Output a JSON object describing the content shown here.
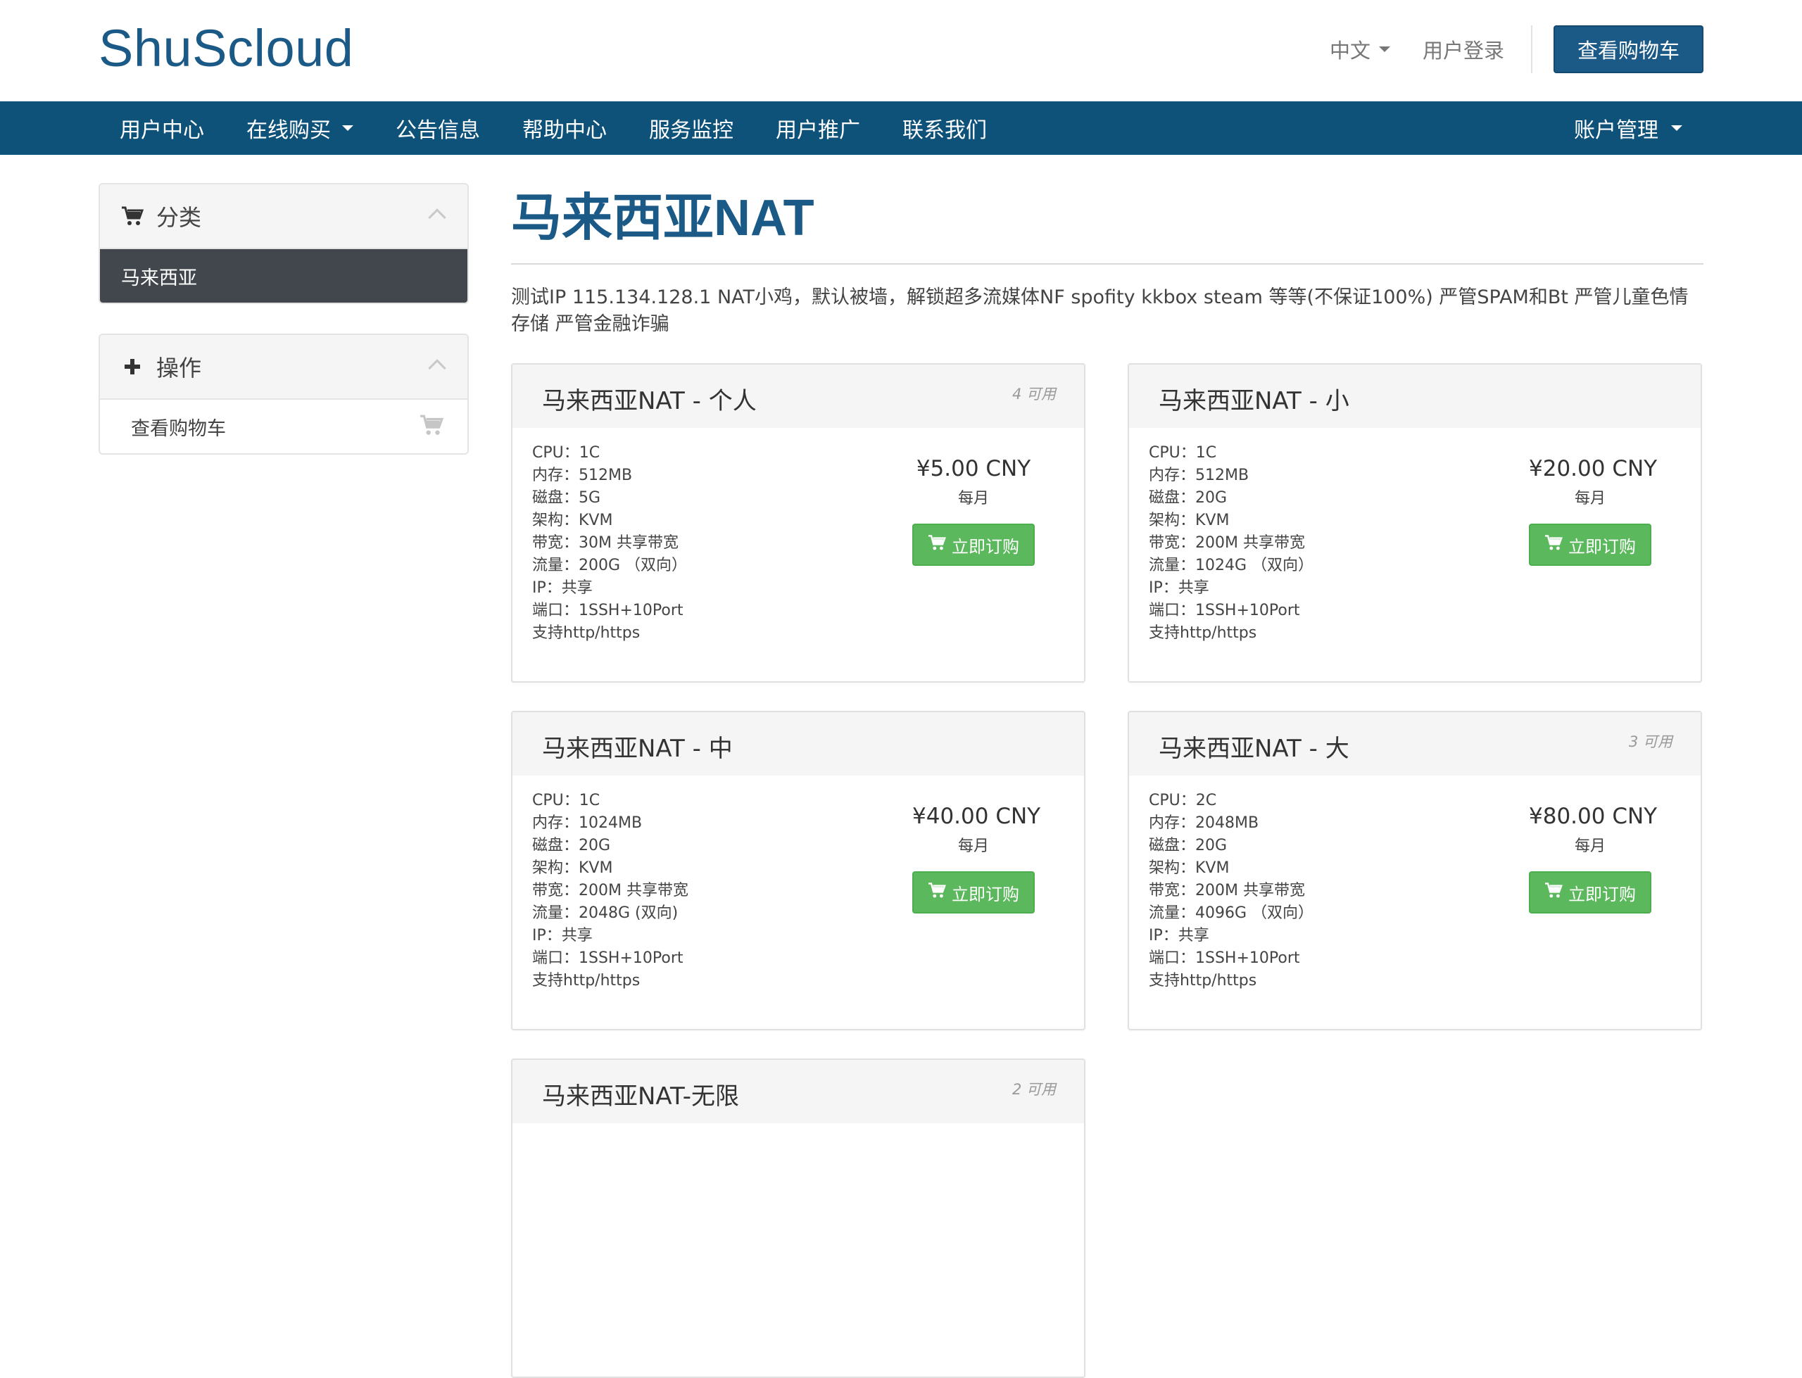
{
  "header": {
    "logo": "ShuScloud",
    "language": "中文",
    "login": "用户登录",
    "view_cart": "查看购物车"
  },
  "nav": {
    "items": [
      {
        "label": "用户中心",
        "dropdown": false
      },
      {
        "label": "在线购买",
        "dropdown": true
      },
      {
        "label": "公告信息",
        "dropdown": false
      },
      {
        "label": "帮助中心",
        "dropdown": false
      },
      {
        "label": "服务监控",
        "dropdown": false
      },
      {
        "label": "用户推广",
        "dropdown": false
      },
      {
        "label": "联系我们",
        "dropdown": false
      }
    ],
    "account": "账户管理"
  },
  "sidebar": {
    "categories": {
      "title": "分类",
      "icon": "cart-icon",
      "items": [
        "马来西亚"
      ]
    },
    "actions": {
      "title": "操作",
      "icon": "plus-icon",
      "items": [
        "查看购物车"
      ]
    }
  },
  "main": {
    "title": "马来西亚NAT",
    "description": "测试IP 115.134.128.1 NAT小鸡，默认被墙，解锁超多流媒体NF spofity kkbox steam 等等(不保证100%) 严管SPAM和Bt 严管儿童色情存储 严管金融诈骗",
    "order_label": "立即订购",
    "products": [
      {
        "name": "马来西亚NAT - 个人",
        "availability": "4 可用",
        "price": "¥5.00 CNY",
        "period": "每月",
        "specs": [
          "CPU：1C",
          "内存：512MB",
          "磁盘：5G",
          "架构：KVM",
          "带宽：30M 共享带宽",
          "流量：200G （双向）",
          "IP：共享",
          "端口：1SSH+10Port",
          "支持http/https"
        ]
      },
      {
        "name": "马来西亚NAT - 小",
        "availability": "",
        "price": "¥20.00 CNY",
        "period": "每月",
        "specs": [
          "CPU：1C",
          "内存：512MB",
          "磁盘：20G",
          "架构：KVM",
          "带宽：200M 共享带宽",
          "流量：1024G （双向）",
          "IP：共享",
          "端口：1SSH+10Port",
          "支持http/https"
        ]
      },
      {
        "name": "马来西亚NAT - 中",
        "availability": "",
        "price": "¥40.00 CNY",
        "period": "每月",
        "specs": [
          "CPU：1C",
          "内存：1024MB",
          "磁盘：20G",
          "架构：KVM",
          "带宽：200M 共享带宽",
          "流量：2048G (双向)",
          "IP：共享",
          "端口：1SSH+10Port",
          "支持http/https"
        ]
      },
      {
        "name": "马来西亚NAT - 大",
        "availability": "3 可用",
        "price": "¥80.00 CNY",
        "period": "每月",
        "specs": [
          "CPU：2C",
          "内存：2048MB",
          "磁盘：20G",
          "架构：KVM",
          "带宽：200M 共享带宽",
          "流量：4096G （双向）",
          "IP：共享",
          "端口：1SSH+10Port",
          "支持http/https"
        ]
      },
      {
        "name": "马来西亚NAT-无限",
        "availability": "2 可用",
        "price": "",
        "period": "",
        "specs": []
      }
    ]
  },
  "colors": {
    "brand": "#1b5a86",
    "nav_bg": "#0f5279",
    "order_button": "#5cb85c",
    "active_item": "#41474d"
  }
}
